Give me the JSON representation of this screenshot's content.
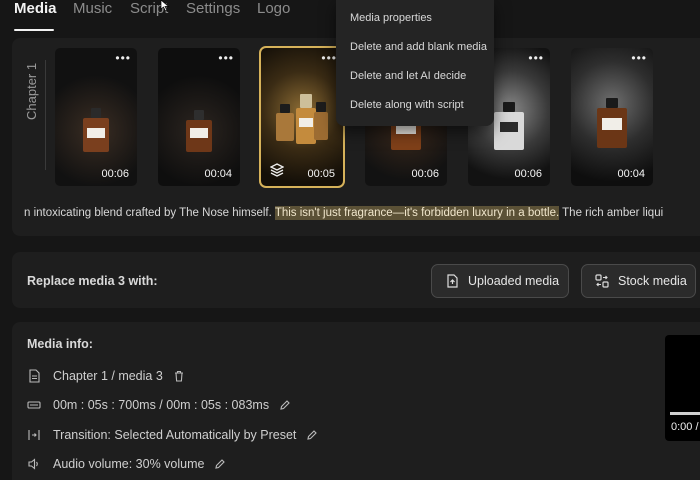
{
  "tabs": [
    {
      "label": "Media",
      "active": true
    },
    {
      "label": "Music",
      "active": false
    },
    {
      "label": "Script",
      "active": false
    },
    {
      "label": "Settings",
      "active": false
    },
    {
      "label": "Logo",
      "active": false
    }
  ],
  "chapter": {
    "label": "Chapter 1"
  },
  "media": [
    {
      "duration": "00:06",
      "selected": false
    },
    {
      "duration": "00:04",
      "selected": false
    },
    {
      "duration": "00:05",
      "selected": true
    },
    {
      "duration": "00:06",
      "selected": false
    },
    {
      "duration": "00:06",
      "selected": false
    },
    {
      "duration": "00:04",
      "selected": false
    }
  ],
  "context_menu": {
    "items": [
      "Media properties",
      "Delete and add blank media",
      "Delete and let AI decide",
      "Delete along with script"
    ]
  },
  "script": {
    "before": "n intoxicating blend crafted by The Nose himself. ",
    "highlight": "This isn't just fragrance—it's forbidden luxury in a bottle.",
    "after": " The rich amber liqui"
  },
  "replace": {
    "label": "Replace media 3 with:",
    "uploaded_label": "Uploaded media",
    "stock_label": "Stock media"
  },
  "info": {
    "title": "Media info:",
    "position": "Chapter 1 / media 3",
    "timing": "00m : 05s : 700ms / 00m : 05s : 083ms",
    "transition": "Transition: Selected Automatically by Preset",
    "volume": "Audio volume: 30% volume"
  },
  "preview": {
    "time": "0:00 /"
  },
  "colors": {
    "accent": "#d6b25a",
    "highlight": "#5b5136",
    "background": "#161616",
    "panel": "#1e1e1e"
  }
}
